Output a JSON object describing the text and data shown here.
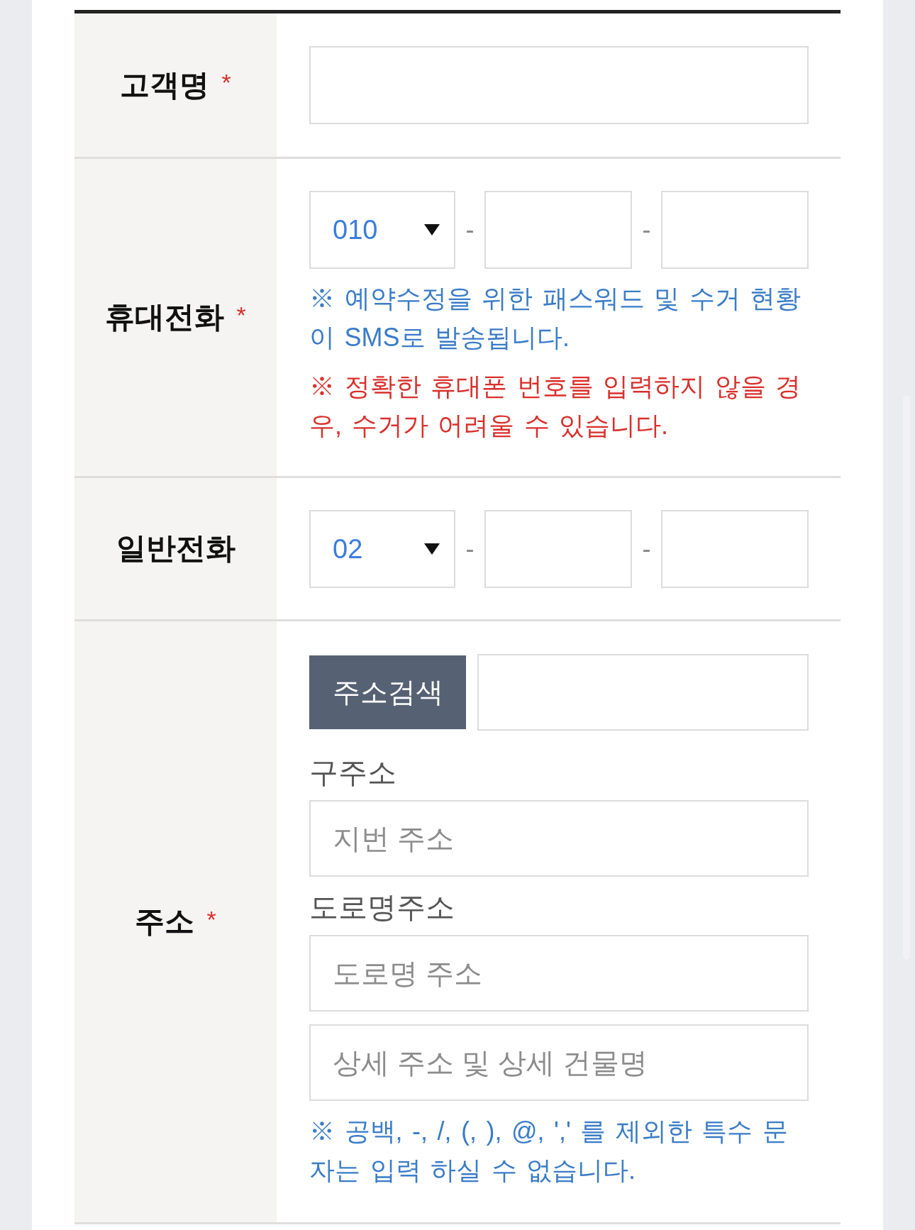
{
  "form": {
    "rows": [
      {
        "kind": "text",
        "label": "고객명",
        "required_mark": "*"
      },
      {
        "kind": "phone",
        "label": "휴대전화",
        "required_mark": "*",
        "area_code": "010",
        "separators": [
          "-",
          "-"
        ],
        "notes": [
          {
            "kind": "info",
            "text": "※ 예약수정을 위한 패스워드 및 수거 현황이 SMS로 발송됩니다."
          },
          {
            "kind": "warning",
            "text": "※ 정확한 휴대폰 번호를 입력하지 않을 경우, 수거가 어려울 수 있습니다."
          }
        ]
      },
      {
        "kind": "phone",
        "label": "일반전화",
        "area_code": "02",
        "separators": [
          "-",
          "-"
        ]
      },
      {
        "kind": "address",
        "label": "주소",
        "required_mark": "*",
        "search_button": "주소검색",
        "groups": [
          {
            "label": "구주소",
            "fields": [
              {
                "placeholder": "지번 주소"
              }
            ]
          },
          {
            "label": "도로명주소",
            "fields": [
              {
                "placeholder": "도로명 주소"
              },
              {
                "placeholder": "상세 주소 및 상세 건물명"
              }
            ]
          }
        ],
        "notes": [
          {
            "kind": "info",
            "text": "※ 공백, -, /, (, ), @, ',' 를 제외한 특수 문자는 입력 하실 수 없습니다."
          }
        ]
      }
    ]
  }
}
